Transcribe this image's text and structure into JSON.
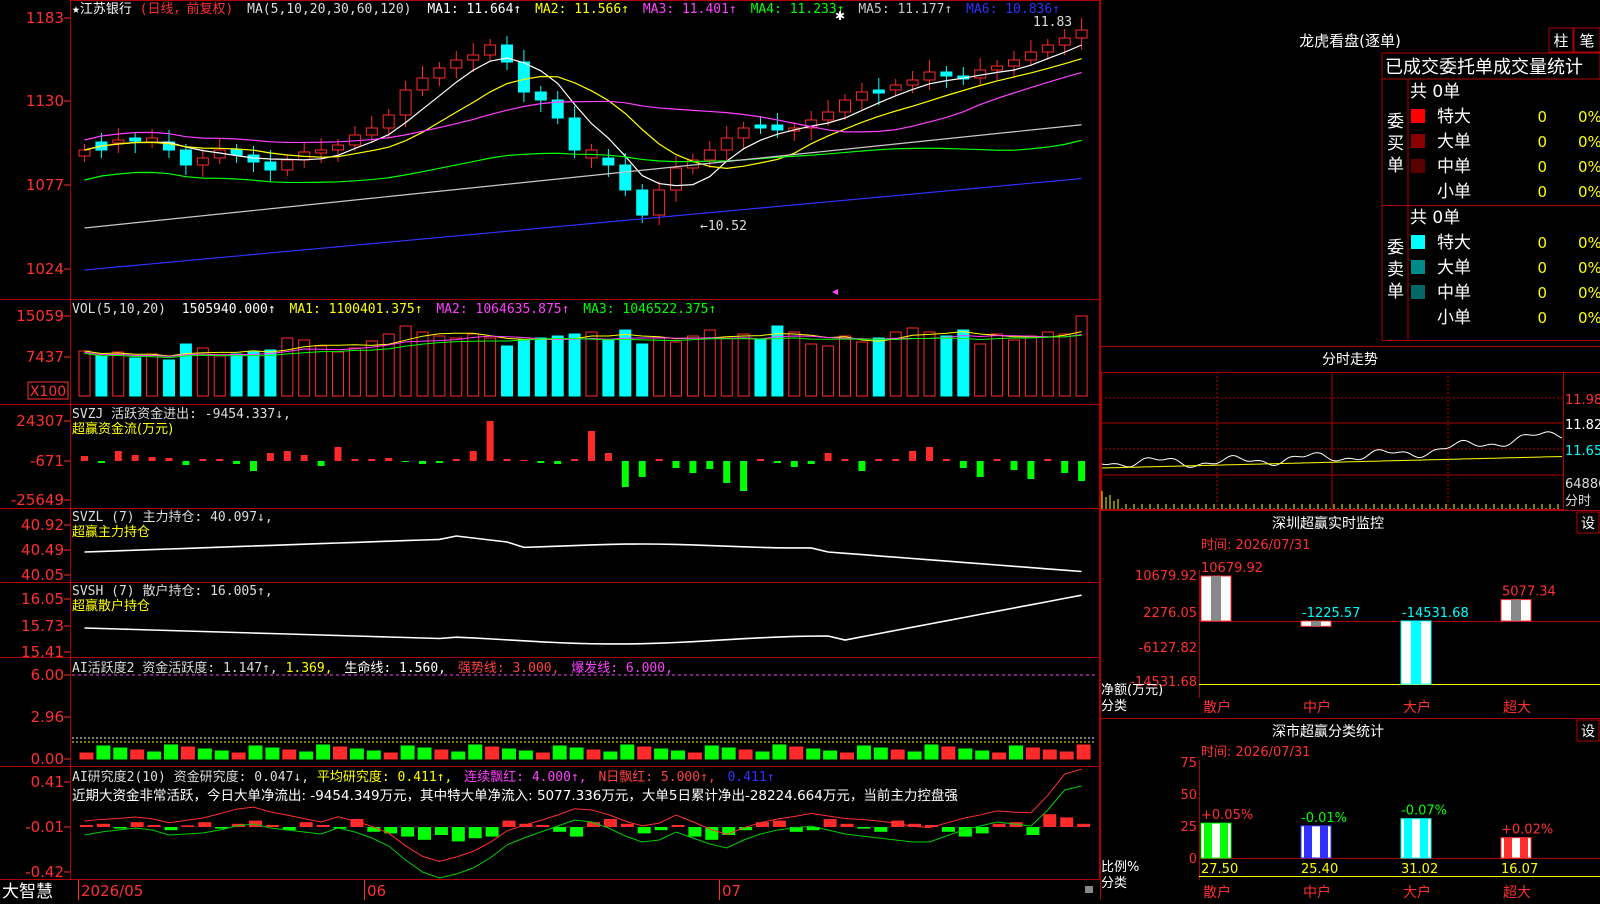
{
  "colors": {
    "up": "#ff2a2a",
    "down": "#00ffff",
    "grid": "#b00000",
    "text": "#cccccc",
    "yellow": "#ffff00",
    "magenta": "#ff40ff",
    "green": "#00ff00",
    "white": "#ffffff",
    "gray": "#b8b8b8",
    "blue": "#3030ff"
  },
  "kline": {
    "stock_name": "★江苏银行",
    "period": "(日线，前复权)",
    "ma_params": "MA(5,10,20,30,60,120)",
    "ma_items": [
      {
        "label": "MA1: 11.664↑",
        "color": "#ffffff"
      },
      {
        "label": "MA2: 11.566↑",
        "color": "#ffff00"
      },
      {
        "label": "MA3: 11.401↑",
        "color": "#ff40ff"
      },
      {
        "label": "MA4: 11.233↑",
        "color": "#00ff00"
      },
      {
        "label": "MA5: 11.177↑",
        "color": "#c8c8c8"
      },
      {
        "label": "MA6: 10.836↑",
        "color": "#3030ff"
      }
    ],
    "y_ticks": [
      "1183",
      "1130",
      "1077",
      "1024"
    ],
    "high_label": "11.83",
    "low_label": "←10.52"
  },
  "volume": {
    "header": "VOL(5,10,20)",
    "value": "1505940.000↑",
    "ma_items": [
      {
        "label": "MA1: 1100401.375↑",
        "color": "#ffff00"
      },
      {
        "label": "MA2: 1064635.875↑",
        "color": "#ff40ff"
      },
      {
        "label": "MA3: 1046522.375↑",
        "color": "#00ff00"
      }
    ],
    "y_ticks": [
      "15059",
      "7437"
    ],
    "unit_badge": "X100"
  },
  "svzj": {
    "header": "SVZJ  活跃资金进出: -9454.337↓,",
    "sub": "超赢资金流(万元)",
    "y_ticks": [
      "24307",
      "-671",
      "-25649"
    ]
  },
  "svzl": {
    "header": "SVZL (7) 主力持仓: 40.097↓,",
    "sub": "超赢主力持仓",
    "y_ticks": [
      "40.92",
      "40.49",
      "40.05"
    ]
  },
  "svsh": {
    "header": "SVSH (7) 散户持仓: 16.005↑,",
    "sub": "超赢散户持仓",
    "y_ticks": [
      "16.05",
      "15.73",
      "15.41"
    ]
  },
  "ai_active": {
    "header_items": [
      {
        "label": "AI活跃度2 资金活跃度: 1.147↑,",
        "color": "#dddddd"
      },
      {
        "label": "1.369,",
        "color": "#ffff00"
      },
      {
        "label": "生命线: 1.560,",
        "color": "#ffffff"
      },
      {
        "label": "强势线: 3.000,",
        "color": "#ff4040"
      },
      {
        "label": "爆发线: 6.000,",
        "color": "#ff40ff"
      }
    ],
    "y_ticks": [
      "6.00",
      "2.96",
      "0.00"
    ]
  },
  "ai_research": {
    "header_items": [
      {
        "label": "AI研究度2(10) 资金研究度: 0.047↓,",
        "color": "#dddddd"
      },
      {
        "label": "平均研究度: 0.411↑,",
        "color": "#ffff00"
      },
      {
        "label": "连续飘红: 4.000↑,",
        "color": "#ff40ff"
      },
      {
        "label": "N日飘红: 5.000↑,",
        "color": "#ff4040"
      },
      {
        "label": "0.411↑",
        "color": "#3030ff"
      }
    ],
    "summary": "近期大资金非常活跃，今日大单净流出: -9454.349万元，其中特大单净流入: 5077.336万元，大单5日累计净出-28224.664万元，当前主力控盘强",
    "y_ticks": [
      "0.41",
      "-0.01",
      "-0.42"
    ]
  },
  "bottom_bar": {
    "brand": "大智慧",
    "dates": [
      "2026/05",
      "06",
      "07"
    ]
  },
  "lhb": {
    "title": "龙虎看盘(逐单)",
    "btn1": "柱",
    "btn2": "笔",
    "tabs": "已成交委托单成交量统计",
    "buy_label": "委买单",
    "sell_label": "委卖单",
    "buy_total": "共 0单",
    "sell_total": "共 0单",
    "buy_rows": [
      {
        "name": "特大",
        "count": "0",
        "pct": "0%",
        "swatch": "#ff0000"
      },
      {
        "name": "大单",
        "count": "0",
        "pct": "0%",
        "swatch": "#8b0000"
      },
      {
        "name": "中单",
        "count": "0",
        "pct": "0%",
        "swatch": "#5a0000"
      },
      {
        "name": "小单",
        "count": "0",
        "pct": "0%",
        "swatch": "#000000"
      }
    ],
    "sell_rows": [
      {
        "name": "特大",
        "count": "0",
        "pct": "0%",
        "swatch": "#00ffff"
      },
      {
        "name": "大单",
        "count": "0",
        "pct": "0%",
        "swatch": "#008b8b"
      },
      {
        "name": "中单",
        "count": "0",
        "pct": "0%",
        "swatch": "#006666"
      },
      {
        "name": "小单",
        "count": "0",
        "pct": "0%",
        "swatch": "#000000"
      }
    ]
  },
  "intraday": {
    "title": "分时走势",
    "price_labels": [
      "11.98",
      "11.82",
      "11.65"
    ],
    "vol_label": "64886",
    "unit": "分时"
  },
  "sz_monitor": {
    "title": "深圳超赢实时监控",
    "settings": "设",
    "time": "时间: 2026/07/31",
    "y_ticks": [
      "10679.92",
      "2276.05",
      "-6127.82",
      "-14531.68"
    ],
    "axis_label_1": "净额(万元)",
    "axis_label_2": "分类",
    "bars": [
      {
        "category": "散户",
        "value": 10679.92,
        "label": "10679.92"
      },
      {
        "category": "中户",
        "value": -1225.57,
        "label": "-1225.57"
      },
      {
        "category": "大户",
        "value": -14531.68,
        "label": "-14531.68"
      },
      {
        "category": "超大",
        "value": 5077.34,
        "label": "5077.34"
      }
    ]
  },
  "sz_class": {
    "title": "深市超赢分类统计",
    "settings": "设",
    "time": "时间: 2026/07/31",
    "y_ticks": [
      "75",
      "50",
      "25",
      "0"
    ],
    "axis_label_1": "比例%",
    "axis_label_2": "分类",
    "bars": [
      {
        "category": "散户",
        "value": 27.5,
        "label": "27.50",
        "change": "+0.05%"
      },
      {
        "category": "中户",
        "value": 25.4,
        "label": "25.40",
        "change": "-0.01%"
      },
      {
        "category": "大户",
        "value": 31.02,
        "label": "31.02",
        "change": "-0.07%"
      },
      {
        "category": "超大",
        "value": 16.07,
        "label": "16.07",
        "change": "+0.02%"
      }
    ]
  }
}
